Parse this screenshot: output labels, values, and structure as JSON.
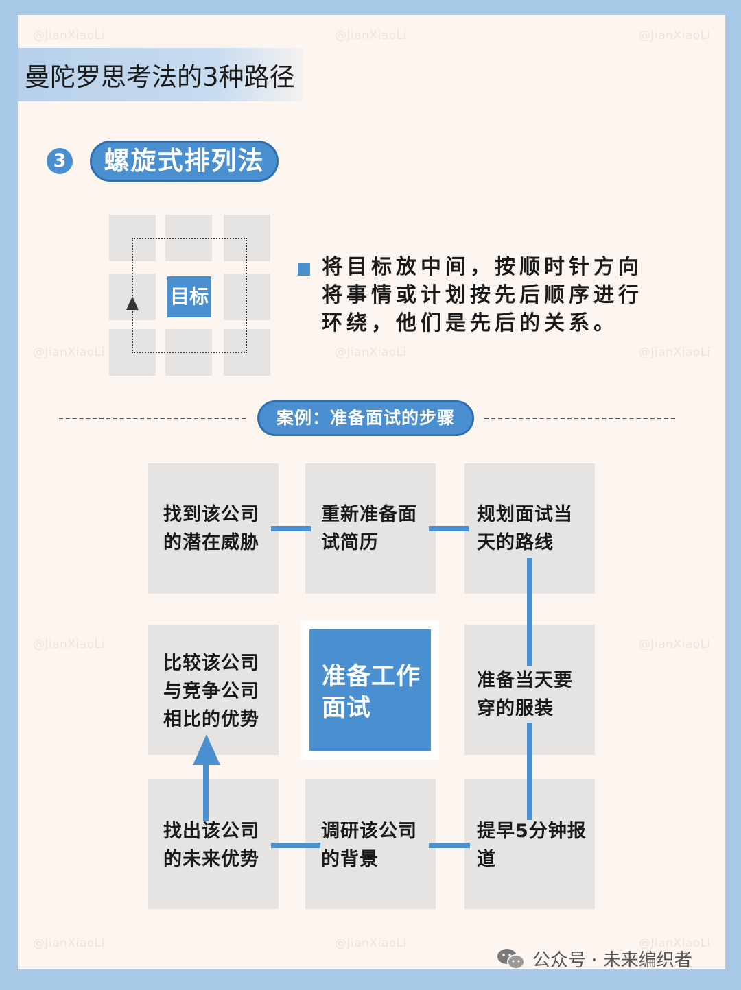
{
  "header": {
    "title": "曼陀罗思考法的3种路径"
  },
  "section": {
    "number": "3",
    "name": "螺旋式排列法"
  },
  "mini_diagram": {
    "goal_label": "目标"
  },
  "description": "将目标放中间，按顺时针方向将事情或计划按先后顺序进行环绕，他们是先后的关系。",
  "case": {
    "title": "案例：准备面试的步骤",
    "center": "准备工作面试",
    "cells": {
      "top_left": "找到该公司的潜在威胁",
      "top_middle": "重新准备面试简历",
      "top_right": "规划面试当天的路线",
      "middle_left": "比较该公司与竞争公司相比的优势",
      "middle_right": "准备当天要穿的服装",
      "bottom_left": "找出该公司的未来优势",
      "bottom_middle": "调研该公司的背景",
      "bottom_right": "提早5分钟报道"
    }
  },
  "watermark": "@JianXiaoLi",
  "footer": {
    "source": "公众号 · 未来编织者"
  },
  "colors": {
    "accent": "#4a8fd0",
    "border": "#a9c9e8",
    "background": "#fdf5ef",
    "cell": "#e6e4e2"
  }
}
